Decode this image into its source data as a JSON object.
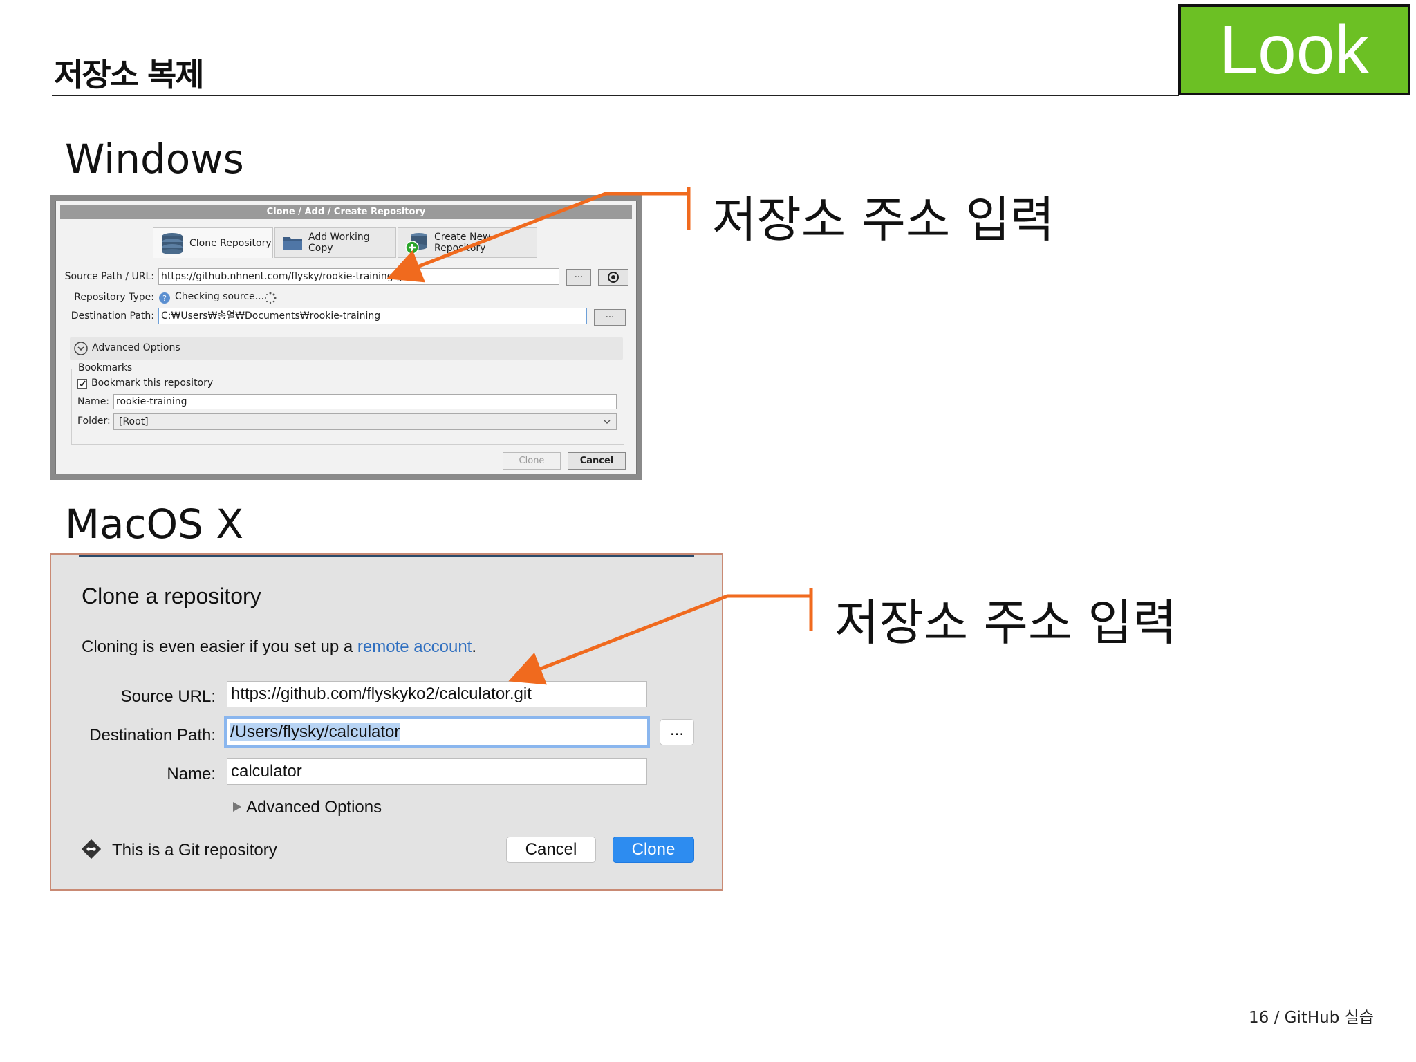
{
  "slide": {
    "title": "저장소 복제",
    "badge": "Look",
    "footer": "16 / GitHub 실습"
  },
  "sections": {
    "windows_heading": "Windows",
    "mac_heading": "MacOS X"
  },
  "annotations": {
    "windows_callout": "저장소 주소 입력",
    "mac_callout": "저장소 주소 입력",
    "arrow_color": "#f06a1e"
  },
  "windows_dialog": {
    "title": "Clone  / Add / Create Repository",
    "tabs": [
      {
        "label": "Clone Repository",
        "icon": "database-stack-icon"
      },
      {
        "label": "Add Working Copy",
        "icon": "folder-icon"
      },
      {
        "label": "Create New Repository",
        "icon": "database-add-icon"
      }
    ],
    "source_label": "Source Path / URL:",
    "source_value": "https://github.nhnent.com/flysky/rookie-training.git",
    "browse_label": "...",
    "repo_type_label": "Repository Type:",
    "repo_type_value": "Checking source...",
    "dest_label": "Destination Path:",
    "dest_value": "C:₩Users₩송열₩Documents₩rookie-training",
    "advanced_label": "Advanced Options",
    "bookmarks_label": "Bookmarks",
    "bookmark_checkbox_label": "Bookmark this repository",
    "name_label": "Name:",
    "name_value": "rookie-training",
    "folder_label": "Folder:",
    "folder_value": "[Root]",
    "clone_button": "Clone",
    "cancel_button": "Cancel"
  },
  "mac_dialog": {
    "title": "Clone a repository",
    "hint_prefix": "Cloning is even easier if you set up a ",
    "hint_link": "remote account",
    "hint_suffix": ".",
    "source_label": "Source URL:",
    "source_value": "https://github.com/flyskyko2/calculator.git",
    "dest_label": "Destination Path:",
    "dest_value": "/Users/flysky/calculator",
    "browse_label": "...",
    "name_label": "Name:",
    "name_value": "calculator",
    "advanced_label": "Advanced Options",
    "repo_kind_text": "This is a Git repository",
    "cancel_button": "Cancel",
    "clone_button": "Clone",
    "accent_color": "#2d8cf0"
  }
}
